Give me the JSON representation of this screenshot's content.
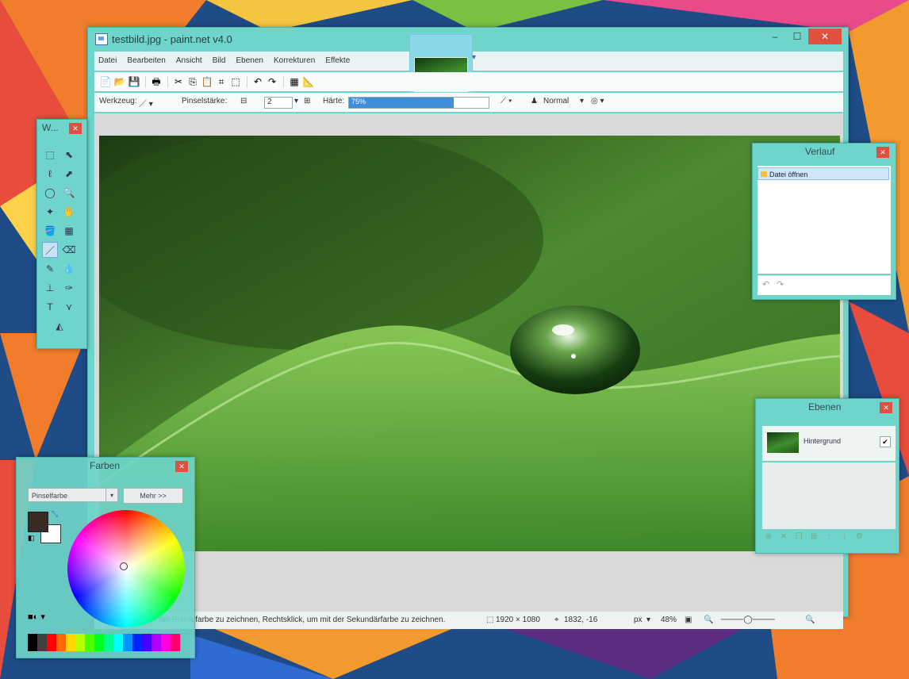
{
  "window": {
    "title": "testbild.jpg - paint.net v4.0",
    "min": "–",
    "max": "☐",
    "close": "✕"
  },
  "menu": [
    "Datei",
    "Bearbeiten",
    "Ansicht",
    "Bild",
    "Ebenen",
    "Korrekturen",
    "Effekte"
  ],
  "options_bar": {
    "tool_label": "Werkzeug:",
    "brush_size_label": "Pinselstärke:",
    "brush_size_value": "2",
    "hardness_label": "Härte:",
    "hardness_value": "75%",
    "hardness_fraction": 0.75,
    "blend_mode": "Normal"
  },
  "status_bar": {
    "hint": "Klicken, um mit der Primärfarbe zu zeichnen, Rechtsklick, um mit der Sekundärfarbe zu zeichnen.",
    "image_size": "1920 × 1080",
    "cursor_pos": "1832, -16",
    "unit": "px",
    "zoom": "48%"
  },
  "tools_window": {
    "title": "W...",
    "close": "✕"
  },
  "history_window": {
    "title": "Verlauf",
    "close": "✕",
    "items": [
      "Datei öffnen"
    ],
    "undo": "↶",
    "redo": "↷"
  },
  "layers_window": {
    "title": "Ebenen",
    "close": "✕",
    "layers": [
      {
        "name": "Hintergrund",
        "visible_mark": "✔"
      }
    ]
  },
  "colors_window": {
    "title": "Farben",
    "close": "✕",
    "select_value": "Pinselfarbe",
    "more_button": "Mehr >>"
  },
  "colors": {
    "window_frame": "#6fd4c9",
    "close_button": "#e0503f",
    "primary_color": "#3a2a24",
    "secondary_color": "#ffffff",
    "accent": "#3e8ed9"
  },
  "icons": {
    "tools": [
      "rect-select-icon",
      "move-selection-icon",
      "lasso-select-icon",
      "move-selected-icon",
      "ellipse-select-icon",
      "zoom-icon",
      "magic-wand-icon",
      "pan-icon",
      "paint-bucket-icon",
      "gradient-icon",
      "paintbrush-icon",
      "eraser-icon",
      "pencil-icon",
      "color-picker-icon",
      "clone-stamp-icon",
      "recolor-icon",
      "text-icon",
      "line-curve-icon",
      "shapes-icon"
    ]
  }
}
